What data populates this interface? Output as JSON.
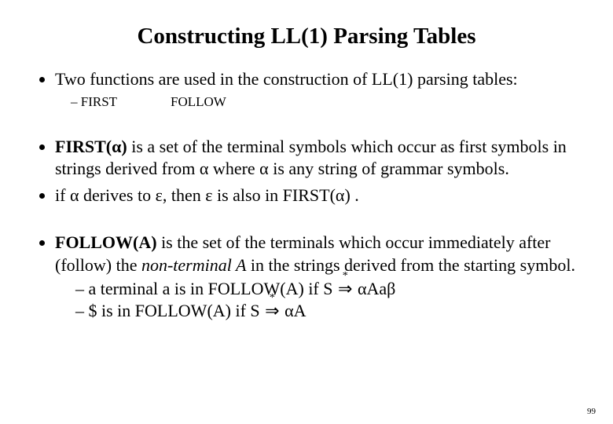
{
  "title": "Constructing LL(1) Parsing Tables",
  "bullets": {
    "intro": "Two functions are used in the construction of LL(1) parsing tables:",
    "funcs": {
      "first": "FIRST",
      "follow": "FOLLOW"
    },
    "first_def_lead": "FIRST(α)",
    "first_def_rest": "  is a set of the terminal symbols which occur as first symbols in strings derived from α where α is any string of grammar symbols.",
    "first_eps": "if α derives to ε, then ε is also in FIRST(α) .",
    "follow_lead": "FOLLOW(A)",
    "follow_rest1": " is the set of the terminals which occur immediately after (follow)  the ",
    "follow_nt": "non-terminal A",
    "follow_rest2": "  in the strings derived from the starting symbol.",
    "follow_sub_a_pre": "a terminal a is in FOLLOW(A)   if   S  ",
    "follow_sub_a_post": " αAaβ",
    "follow_sub_b_pre": "$ is in FOLLOW(A)     if   S  ",
    "follow_sub_b_post": " αA",
    "derive_sym": "⇒",
    "star": "*"
  },
  "page_number": "99"
}
